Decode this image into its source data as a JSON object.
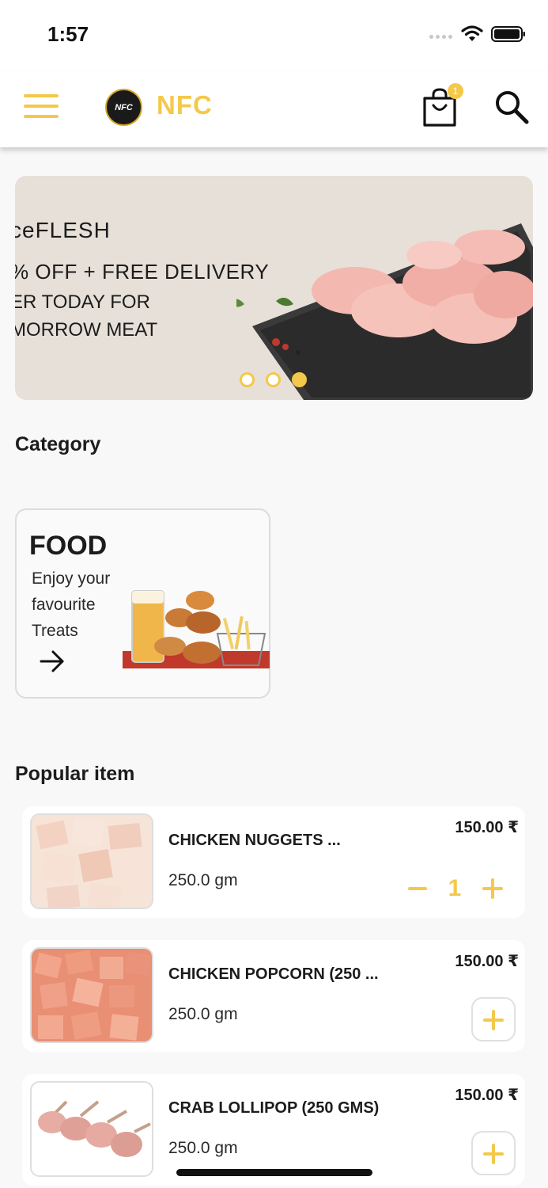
{
  "status_bar": {
    "time": "1:57"
  },
  "header": {
    "logo_text": "NFC",
    "brand": "NFC",
    "cart_count": "1"
  },
  "banner": {
    "line1": "ceFLESH",
    "line2": "% OFF + FREE DELIVERY",
    "line3": "ER TODAY FOR",
    "line4": "MORROW MEAT",
    "slides": 3,
    "active_slide": 3
  },
  "category": {
    "title": "Category",
    "card": {
      "title": "FOOD",
      "subtitle": "Enjoy your favourite Treats"
    }
  },
  "popular": {
    "title": "Popular item",
    "items": [
      {
        "name": "CHICKEN NUGGETS ...",
        "weight": "250.0 gm",
        "price": "150.00 ₹",
        "quantity": "1"
      },
      {
        "name": "CHICKEN POPCORN (250 ...",
        "weight": "250.0 gm",
        "price": "150.00 ₹"
      },
      {
        "name": "CRAB LOLLIPOP (250 GMS)",
        "weight": "250.0 gm",
        "price": "150.00 ₹"
      }
    ]
  },
  "colors": {
    "accent": "#f4c84a",
    "background": "#f8f8f8"
  }
}
